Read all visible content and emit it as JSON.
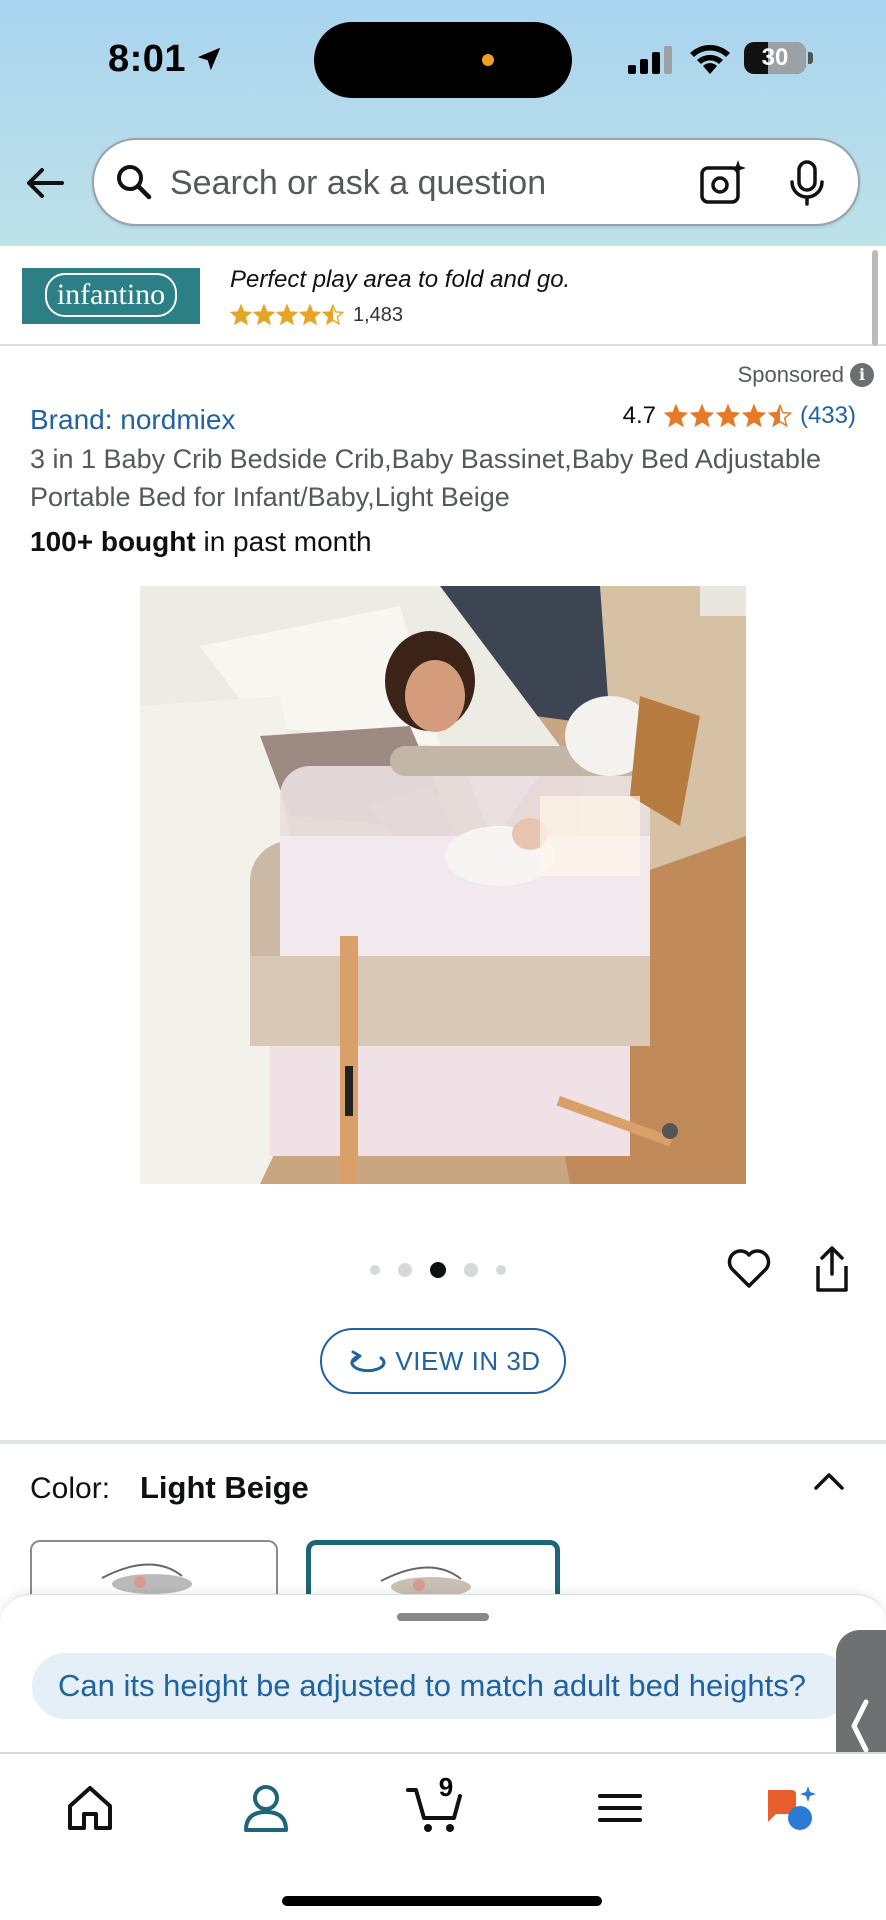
{
  "status_bar": {
    "time": "8:01",
    "battery": "30"
  },
  "search": {
    "placeholder": "Search or ask a question"
  },
  "ad": {
    "brand_logo": "infantino",
    "tagline": "Perfect play area to fold and go.",
    "rating_stars": 4.5,
    "review_count": "1,483"
  },
  "product": {
    "sponsored_label": "Sponsored",
    "brand": "Brand: nordmiex",
    "rating": "4.7",
    "rating_stars": 4.5,
    "rating_count": "(433)",
    "title": "3 in 1 Baby Crib Bedside Crib,Baby Bassinet,Baby Bed Adjustable Portable Bed for Infant/Baby,Light Beige",
    "bought_bold": "100+ bought",
    "bought_rest": " in past month",
    "image_count": 5,
    "active_image_index": 2
  },
  "view3d_label": "VIEW IN 3D",
  "color": {
    "label": "Color:",
    "value": "Light Beige"
  },
  "rufus": {
    "question": "Can its height be adjusted to match adult bed heights?"
  },
  "nav": {
    "cart_count": "9"
  },
  "colors": {
    "link": "#2162a1",
    "star": "#e57a27",
    "teal": "#1d6577",
    "header_top": "#a9d4ef"
  },
  "icons": [
    "location-arrow-icon",
    "signal-icon",
    "wifi-icon",
    "battery-icon",
    "back-arrow-icon",
    "search-icon",
    "camera-search-icon",
    "mic-icon",
    "info-icon",
    "heart-icon",
    "share-icon",
    "rotate-3d-icon",
    "chevron-up-icon",
    "chevron-left-icon",
    "home-icon",
    "user-icon",
    "cart-icon",
    "menu-icon",
    "rufus-icon"
  ]
}
